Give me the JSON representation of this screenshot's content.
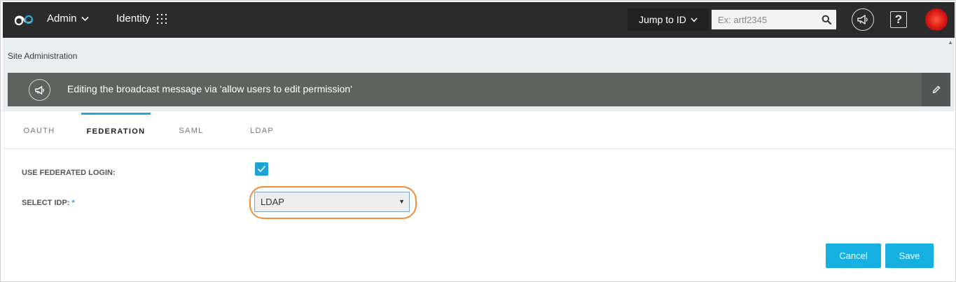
{
  "header": {
    "admin_label": "Admin",
    "identity_label": "Identity",
    "jump_label": "Jump to ID",
    "search_placeholder": "Ex: artf2345",
    "help_label": "?"
  },
  "breadcrumb": "Site Administration",
  "banner": {
    "message": "Editing the broadcast message via 'allow users to edit permission'"
  },
  "tabs": [
    {
      "label": "OAUTH",
      "active": false
    },
    {
      "label": "FEDERATION",
      "active": true
    },
    {
      "label": "SAML",
      "active": false
    },
    {
      "label": "LDAP",
      "active": false
    }
  ],
  "form": {
    "federated_login_label": "USE FEDERATED LOGIN:",
    "federated_login_checked": true,
    "select_idp_label": "SELECT IDP:",
    "required_mark": "*",
    "select_idp_value": "LDAP"
  },
  "buttons": {
    "cancel": "Cancel",
    "save": "Save"
  },
  "colors": {
    "accent": "#16b0e3",
    "topbar": "#2b2b2b",
    "banner": "#5d6460",
    "highlight": "#f08c3a"
  }
}
